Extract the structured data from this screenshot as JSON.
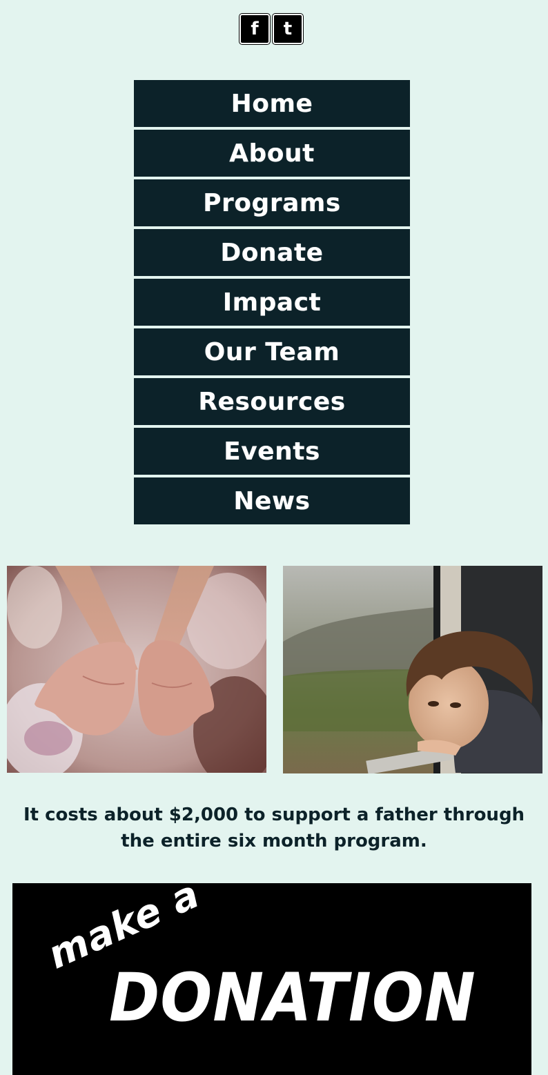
{
  "social": {
    "facebook": {
      "icon": "facebook-icon",
      "glyph": "f"
    },
    "twitter": {
      "icon": "twitter-icon",
      "glyph": "t"
    }
  },
  "nav": {
    "items": [
      {
        "label": "Home"
      },
      {
        "label": "About"
      },
      {
        "label": "Programs"
      },
      {
        "label": "Donate"
      },
      {
        "label": "Impact"
      },
      {
        "label": "Our Team"
      },
      {
        "label": "Resources"
      },
      {
        "label": "Events"
      },
      {
        "label": "News"
      }
    ]
  },
  "photos": {
    "left": {
      "subject": "child-open-hands-photo"
    },
    "right": {
      "subject": "boy-at-rainy-window-photo"
    }
  },
  "cost_statement": "It costs about $2,000 to support a father through the entire six month program.",
  "donation_banner": {
    "line1": "make a",
    "line2": "DONATION"
  },
  "colors": {
    "background": "#e3f4ef",
    "nav_bg": "#0c2229",
    "text_dark": "#0c2229",
    "banner_bg": "#000000"
  }
}
